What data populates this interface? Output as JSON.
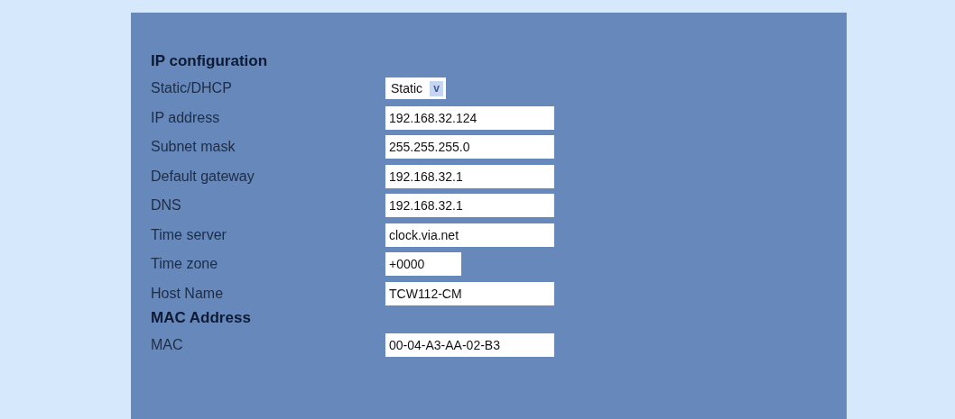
{
  "sections": [
    {
      "heading": "IP configuration",
      "rows": [
        {
          "kind": "select",
          "label": "Static/DHCP",
          "value": "Static",
          "arrow": "v"
        },
        {
          "kind": "text",
          "label": "IP address",
          "value": "192.168.32.124"
        },
        {
          "kind": "text",
          "label": "Subnet mask",
          "value": "255.255.255.0"
        },
        {
          "kind": "text",
          "label": "Default gateway",
          "value": "192.168.32.1"
        },
        {
          "kind": "text",
          "label": "DNS",
          "value": "192.168.32.1"
        },
        {
          "kind": "text",
          "label": "Time server",
          "value": "clock.via.net"
        },
        {
          "kind": "short",
          "label": "Time zone",
          "value": "+0000"
        },
        {
          "kind": "text",
          "label": "Host Name",
          "value": "TCW112-CM"
        }
      ]
    },
    {
      "heading": "MAC Address",
      "rows": [
        {
          "kind": "text",
          "label": "MAC",
          "value": "00-04-A3-AA-02-B3"
        }
      ]
    }
  ]
}
